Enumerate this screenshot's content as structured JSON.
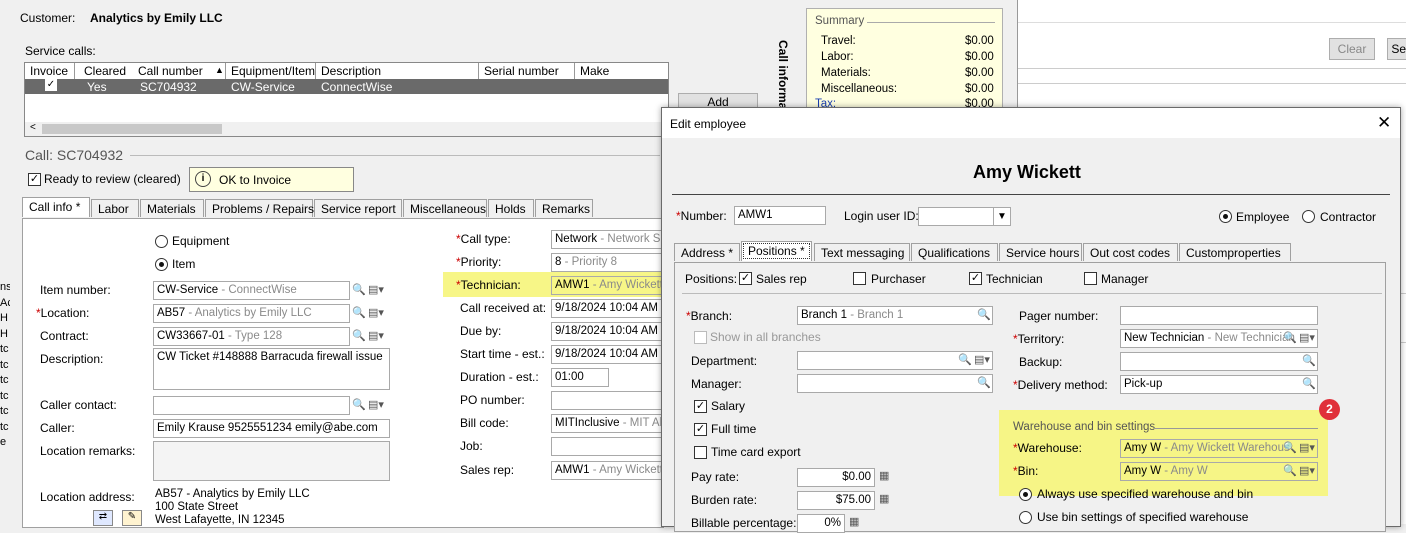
{
  "customer": {
    "label": "Customer:",
    "name": "Analytics by Emily LLC"
  },
  "service_calls": {
    "label": "Service calls:",
    "columns": [
      "Invoice",
      "Cleared",
      "Call number",
      "Equipment/Item",
      "Description",
      "Serial number",
      "Make"
    ],
    "row": {
      "invoice": "✓",
      "cleared": "Yes",
      "call_number": "SC704932",
      "equipment": "CW-Service",
      "description": "ConnectWise"
    },
    "add_label": "Add",
    "side_label": "Call informa"
  },
  "summary": {
    "title": "Summary",
    "rows": [
      {
        "label": "Travel:",
        "value": "$0.00"
      },
      {
        "label": "Labor:",
        "value": "$0.00"
      },
      {
        "label": "Materials:",
        "value": "$0.00"
      },
      {
        "label": "Miscellaneous:",
        "value": "$0.00"
      },
      {
        "label": "Tax:",
        "value": "$0.00"
      }
    ]
  },
  "right_buttons": {
    "clear": "Clear",
    "search": "Sea"
  },
  "call": {
    "title": "Call: SC704932",
    "ready_label": "Ready to review (cleared)",
    "ok_invoice": "OK to Invoice",
    "tabs": [
      "Call info *",
      "Labor",
      "Materials",
      "Problems / Repairs",
      "Service report",
      "Miscellaneous",
      "Holds",
      "Remarks"
    ],
    "equipment_label": "Equipment",
    "item_label": "Item",
    "item_number_label": "Item number:",
    "item_number": "CW-Service",
    "item_number_desc": " - ConnectWise",
    "location_label": "Location:",
    "location": "AB57",
    "location_desc": " - Analytics by Emily LLC",
    "contract_label": "Contract:",
    "contract": "CW33667-01",
    "contract_desc": " - Type 128",
    "description_label": "Description:",
    "description": "CW Ticket #148888 Barracuda firewall issue",
    "caller_contact_label": "Caller contact:",
    "caller_label": "Caller:",
    "caller": "Emily Krause 9525551234 emily@abe.com",
    "location_remarks_label": "Location remarks:",
    "location_address_label": "Location address:",
    "address_lines": [
      "AB57 - Analytics by Emily LLC",
      "100 State Street",
      "West Lafayette, IN 12345"
    ],
    "call_type_label": "Call type:",
    "call_type": "Network",
    "call_type_desc": " - Network Sup",
    "priority_label": "Priority:",
    "priority": "8",
    "priority_desc": " - Priority 8",
    "technician_label": "Technician:",
    "technician": "AMW1",
    "technician_desc": " - Amy Wickett",
    "call_received_label": "Call received at:",
    "call_received": "9/18/2024 10:04 AM",
    "due_by_label": "Due by:",
    "due_by": "9/18/2024 10:04 AM",
    "start_time_label": "Start time - est.:",
    "start_time": "9/18/2024 10:04 AM",
    "duration_label": "Duration - est.:",
    "duration": "01:00",
    "po_label": "PO number:",
    "bill_code_label": "Bill code:",
    "bill_code": "MITInclusive",
    "bill_code_desc": " - MIT All I",
    "job_label": "Job:",
    "sales_rep_label": "Sales rep:",
    "sales_rep": "AMW1",
    "sales_rep_desc": " - Amy Wickett"
  },
  "left_strip": [
    "ns",
    "Ac",
    "H",
    "H",
    "tc",
    "tc",
    "tc",
    "tc",
    "tc",
    "tc",
    "e"
  ],
  "edit_employee": {
    "title": "Edit employee",
    "name": "Amy Wickett",
    "number_label": "Number:",
    "number": "AMW1",
    "login_label": "Login user ID:",
    "employee_label": "Employee",
    "contractor_label": "Contractor",
    "tabs": [
      "Address *",
      "Positions *",
      "Text messaging",
      "Qualifications",
      "Service hours",
      "Out cost codes",
      "Customproperties"
    ],
    "positions_label": "Positions:",
    "pos_sales_rep": "Sales rep",
    "pos_purchaser": "Purchaser",
    "pos_technician": "Technician",
    "pos_manager": "Manager",
    "branch_label": "Branch:",
    "branch": "Branch 1",
    "branch_desc": " - Branch 1",
    "show_all_label": "Show in all branches",
    "department_label": "Department:",
    "manager_label": "Manager:",
    "salary_label": "Salary",
    "fulltime_label": "Full time",
    "timecard_label": "Time card export",
    "pay_rate_label": "Pay rate:",
    "pay_rate": "$0.00",
    "burden_rate_label": "Burden rate:",
    "burden_rate": "$75.00",
    "billable_label": "Billable percentage:",
    "billable": "0%",
    "pager_label": "Pager number:",
    "territory_label": "Territory:",
    "territory": "New Technician",
    "territory_desc": " - New Technician",
    "backup_label": "Backup:",
    "delivery_label": "Delivery method:",
    "delivery": "Pick-up",
    "warehouse_group": "Warehouse and bin settings",
    "warehouse_label": "Warehouse:",
    "warehouse": "Amy W",
    "warehouse_desc": " - Amy Wickett Warehous",
    "bin_label": "Bin:",
    "bin": "Amy W",
    "bin_desc": " - Amy W",
    "always_label": "Always use specified warehouse and bin",
    "use_bin_label": "Use bin settings of specified warehouse",
    "callout": "2"
  },
  "colors": {
    "highlight": "#f6f57a",
    "callout": "#e0303a",
    "summary_bg": "#ffffe0"
  }
}
